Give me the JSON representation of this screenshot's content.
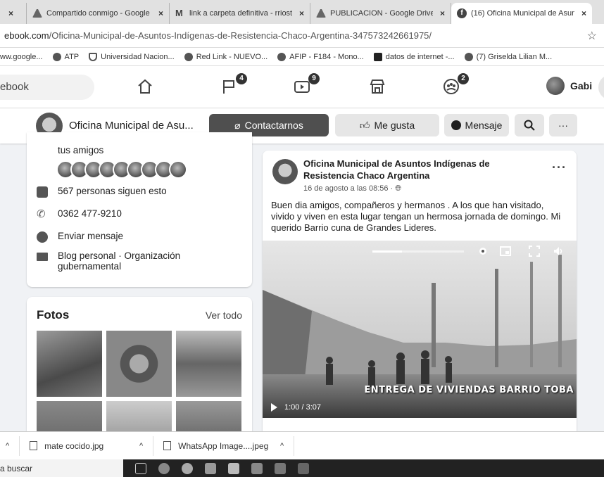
{
  "browser": {
    "tabs": [
      {
        "label": "",
        "icon": "tab-icon",
        "close": "×"
      },
      {
        "label": "Compartido conmigo - Google",
        "icon": "drive-icon",
        "close": "×"
      },
      {
        "label": "link a carpeta definitiva - rriost",
        "icon": "gmail-icon",
        "close": "×"
      },
      {
        "label": "PUBLICACION - Google Drive",
        "icon": "drive-icon",
        "close": "×"
      },
      {
        "label": "(16) Oficina Municipal de Asun",
        "icon": "facebook-icon",
        "close": "×"
      }
    ],
    "url_prefix": "ebook.com",
    "url_rest": "/Oficina-Municipal-de-Asuntos-Indígenas-de-Resistencia-Chaco-Argentina-347573242661975/",
    "bookmarks": [
      "ww.google...",
      "ATP",
      "Universidad Nacion...",
      "Red Link - NUEVO...",
      "AFIP - F184 - Mono...",
      "datos de internet -...",
      "(7) Griselda Lilian M..."
    ]
  },
  "fbnav": {
    "search_placeholder": "ebook",
    "badges": {
      "flag": "4",
      "watch": "9",
      "groups": "2"
    },
    "user_name": "Gabi"
  },
  "pagebar": {
    "page_name": "Oficina Municipal de Asu...",
    "contact_label": "Contactarnos",
    "like_label": "Me gusta",
    "message_label": "Mensaje",
    "more_label": "···"
  },
  "intro": {
    "friends_text": "tus amigos",
    "followers": "567 personas siguen esto",
    "phone": "0362 477-9210",
    "send_message": "Enviar mensaje",
    "category": "Blog personal · Organización gubernamental"
  },
  "photos": {
    "title": "Fotos",
    "see_all": "Ver todo"
  },
  "post": {
    "author": "Oficina Municipal de Asuntos Indígenas de Resistencia Chaco Argentina",
    "date": "16 de agosto a las 08:56 · ",
    "more": "···",
    "text": "Buen dia amigos, compañeros y hermanos . A los que han visitado, vivido y viven en esta lugar tengan un hermosa jornada de domingo. Mi querido Barrio cuna de Grandes Lideres.",
    "video_caption": "ENTREGA DE VIVIENDAS BARRIO TOBA",
    "video_time": "1:00 / 3:07",
    "video_progress": 0.32
  },
  "downloads": [
    {
      "name": ""
    },
    {
      "name": "mate cocido.jpg"
    },
    {
      "name": "WhatsApp Image....jpeg"
    }
  ],
  "taskbar": {
    "search_text": "a buscar"
  }
}
